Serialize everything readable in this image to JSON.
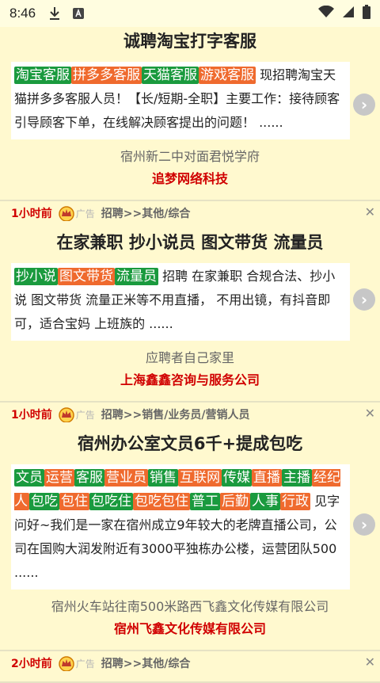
{
  "statusbar": {
    "time": "8:46"
  },
  "cards": [
    {
      "title": "诚聘淘宝打字客服",
      "tags": [
        {
          "text": "淘宝客服",
          "color": "green"
        },
        {
          "text": "拼多多客服",
          "color": "orange"
        },
        {
          "text": "天猫客服",
          "color": "green"
        },
        {
          "text": "游戏客服",
          "color": "orange"
        }
      ],
      "desc": " 现招聘淘宝天猫拼多多客服人员！【长/短期-全职】主要工作：接待顾客引导顾客下单，在线解决顾客提出的问题！ ......",
      "address": "宿州新二中对面君悦学府",
      "company": "追梦网络科技"
    },
    {
      "ago": "1小时前",
      "ad": "广告",
      "category": "招聘>>其他/综合",
      "title": "在家兼职 抄小说员 图文带货 流量员",
      "tags": [
        {
          "text": "抄小说",
          "color": "green"
        },
        {
          "text": "图文带货",
          "color": "orange"
        },
        {
          "text": "流量员",
          "color": "green"
        }
      ],
      "desc": " 招聘 在家兼职 合规合法、抄小说 图文带货 流量正米等不用直播， 不用出镜，有抖音即可，适合宝妈 上班族的 ......",
      "address": "应聘者自己家里",
      "company": "上海鑫鑫咨询与服务公司"
    },
    {
      "ago": "1小时前",
      "ad": "广告",
      "category": "招聘>>销售/业务员/营销人员",
      "title": "宿州办公室文员6千+提成包吃",
      "tags": [
        {
          "text": "文员",
          "color": "green"
        },
        {
          "text": "运营",
          "color": "orange"
        },
        {
          "text": "客服",
          "color": "green"
        },
        {
          "text": "营业员",
          "color": "orange"
        },
        {
          "text": "销售",
          "color": "green"
        },
        {
          "text": "互联网",
          "color": "orange"
        },
        {
          "text": "传媒",
          "color": "green"
        },
        {
          "text": "直播",
          "color": "orange"
        },
        {
          "text": "主播",
          "color": "green"
        },
        {
          "text": "经纪人",
          "color": "orange"
        },
        {
          "text": "包吃",
          "color": "green"
        },
        {
          "text": "包住",
          "color": "orange"
        },
        {
          "text": "包吃住",
          "color": "green"
        },
        {
          "text": "包吃包住",
          "color": "orange"
        },
        {
          "text": "普工",
          "color": "green"
        },
        {
          "text": "后勤",
          "color": "orange"
        },
        {
          "text": "人事",
          "color": "green"
        },
        {
          "text": "行政",
          "color": "orange"
        }
      ],
      "desc": " 见字问好~我们是一家在宿州成立9年较大的老牌直播公司，公司在国购大润发附近有3000平独栋办公楼，运营团队500 ......",
      "address": "宿州火车站往南500米路西飞鑫文化传媒有限公司",
      "company": "宿州飞鑫文化传媒有限公司"
    },
    {
      "ago": "2小时前",
      "ad": "广告",
      "category": "招聘>>其他/综合"
    }
  ],
  "icons": {
    "download": "download-icon",
    "app": "app-notification-icon",
    "wifi": "wifi-icon",
    "signal": "signal-icon",
    "battery": "battery-icon",
    "crown": "crown-icon",
    "close": "close-icon",
    "chevron": "chevron-right-icon"
  }
}
